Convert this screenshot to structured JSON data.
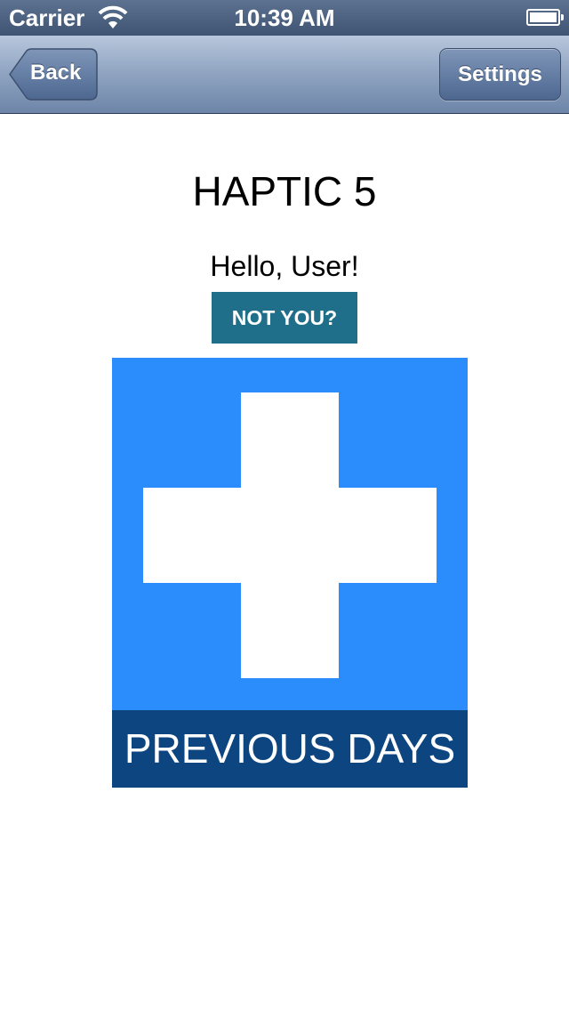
{
  "status_bar": {
    "carrier": "Carrier",
    "time": "10:39 AM",
    "icons": [
      "wifi-icon",
      "battery-icon"
    ]
  },
  "nav_bar": {
    "back_label": "Back",
    "settings_label": "Settings"
  },
  "main": {
    "title": "HAPTIC 5",
    "greeting": "Hello, User!",
    "not_you_label": "NOT YOU?",
    "add_icon": "plus-icon",
    "previous_days_label": "PREVIOUS DAYS"
  },
  "colors": {
    "not_you_button": "#1f6f8b",
    "add_tile": "#2a8dfb",
    "previous_days_button": "#0d4580"
  }
}
